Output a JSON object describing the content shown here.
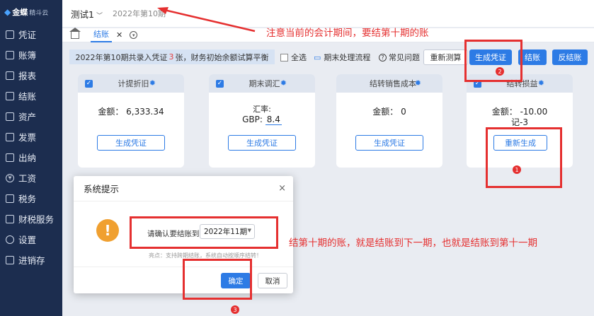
{
  "sidebar": {
    "logo_main": "金蝶",
    "logo_sub": "精斗云",
    "items": [
      {
        "label": "凭证",
        "icon": "voucher-icon"
      },
      {
        "label": "账簿",
        "icon": "ledger-icon"
      },
      {
        "label": "报表",
        "icon": "report-icon"
      },
      {
        "label": "结账",
        "icon": "closing-icon"
      },
      {
        "label": "资产",
        "icon": "asset-icon"
      },
      {
        "label": "发票",
        "icon": "invoice-icon"
      },
      {
        "label": "出纳",
        "icon": "cashier-icon"
      },
      {
        "label": "工资",
        "icon": "salary-icon"
      },
      {
        "label": "税务",
        "icon": "tax-icon"
      },
      {
        "label": "财税服务",
        "icon": "service-icon"
      },
      {
        "label": "设置",
        "icon": "settings-icon"
      },
      {
        "label": "进销存",
        "icon": "inventory-icon"
      }
    ]
  },
  "topbar": {
    "account": "测试1",
    "period": "2022年第10期"
  },
  "tabs": {
    "active_label": "结账",
    "close_glyph": "✕"
  },
  "toolbar": {
    "info_prefix": "2022年第10期共录入凭证",
    "info_count": "3",
    "info_suffix": "张，财务初始余额试算平衡",
    "select_all": "全选",
    "flow_link": "期末处理流程",
    "faq_link": "常见问题",
    "recalc": "重新测算",
    "generate_voucher": "生成凭证",
    "close_books": "结账",
    "reverse_close": "反结账"
  },
  "cards": [
    {
      "title": "计提折旧",
      "line1": "金额： 6,333.34",
      "button": "生成凭证"
    },
    {
      "title": "期末调汇",
      "rate_label": "汇率:",
      "currency": "GBP:",
      "rate": "8.4",
      "button": "生成凭证"
    },
    {
      "title": "结转销售成本",
      "line1": "金额： 0",
      "button": "生成凭证"
    },
    {
      "title": "结转损益",
      "line1": "金额： -10.00",
      "line2": "记-3",
      "button": "重新生成"
    }
  ],
  "dialog": {
    "title": "系统提示",
    "close_glyph": "×",
    "warn_glyph": "!",
    "confirm_label": "请确认要结账到",
    "selected_period": "2022年11期",
    "tip": "亮点：支持跨期结账，系统自动按顺序结转！",
    "ok": "确定",
    "cancel": "取消"
  },
  "annotations": {
    "note_top": "注意当前的会计期间，要结第十期的账",
    "note_mid": "结第十期的账，就是结账到下一期，也就是结账到第十一期",
    "num1": "1",
    "num2": "2",
    "num3": "3",
    "color": "#e53030"
  }
}
